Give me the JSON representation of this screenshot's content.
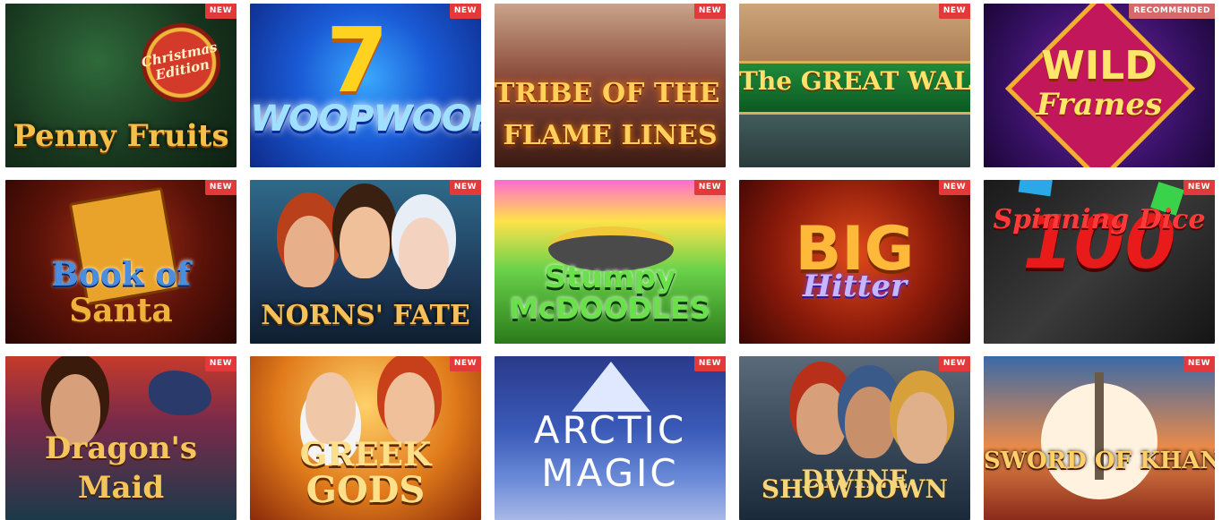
{
  "games": [
    {
      "title": "Penny Fruits",
      "subtitle": "Christmas Edition",
      "badge": "NEW"
    },
    {
      "title": "WOOPWOOP",
      "badge": "NEW"
    },
    {
      "title": "FLAME LINES",
      "subtitle": "TRIBE OF THE SUN",
      "badge": "NEW"
    },
    {
      "title": "The GREAT WALL",
      "badge": "NEW"
    },
    {
      "title": "WILD",
      "title2": "Frames",
      "badge": "RECOMMENDED"
    },
    {
      "title": "Book of",
      "title2": "Santa",
      "badge": "NEW"
    },
    {
      "title": "NORNS' FATE",
      "badge": "NEW"
    },
    {
      "title": "Stumpy",
      "title2": "McDOODLES",
      "badge": "NEW"
    },
    {
      "title": "BIG",
      "title2": "Hitter",
      "badge": "NEW"
    },
    {
      "title": "100",
      "title2": "Spinning Dice",
      "badge": "NEW"
    },
    {
      "title": "Dragon's",
      "title2": "Maid",
      "badge": "NEW"
    },
    {
      "title": "GREEK",
      "title2": "GODS",
      "badge": "NEW"
    },
    {
      "title": "ARCTIC",
      "title2": "MAGIC",
      "badge": "NEW"
    },
    {
      "title": "SHOWDOWN",
      "subtitle": "DIVINE",
      "badge": "NEW"
    },
    {
      "title": "SWORD OF KHANS",
      "badge": "NEW"
    }
  ],
  "colors": {
    "badge_new": "#e23a3a",
    "badge_recommended": "#d66a6a"
  }
}
